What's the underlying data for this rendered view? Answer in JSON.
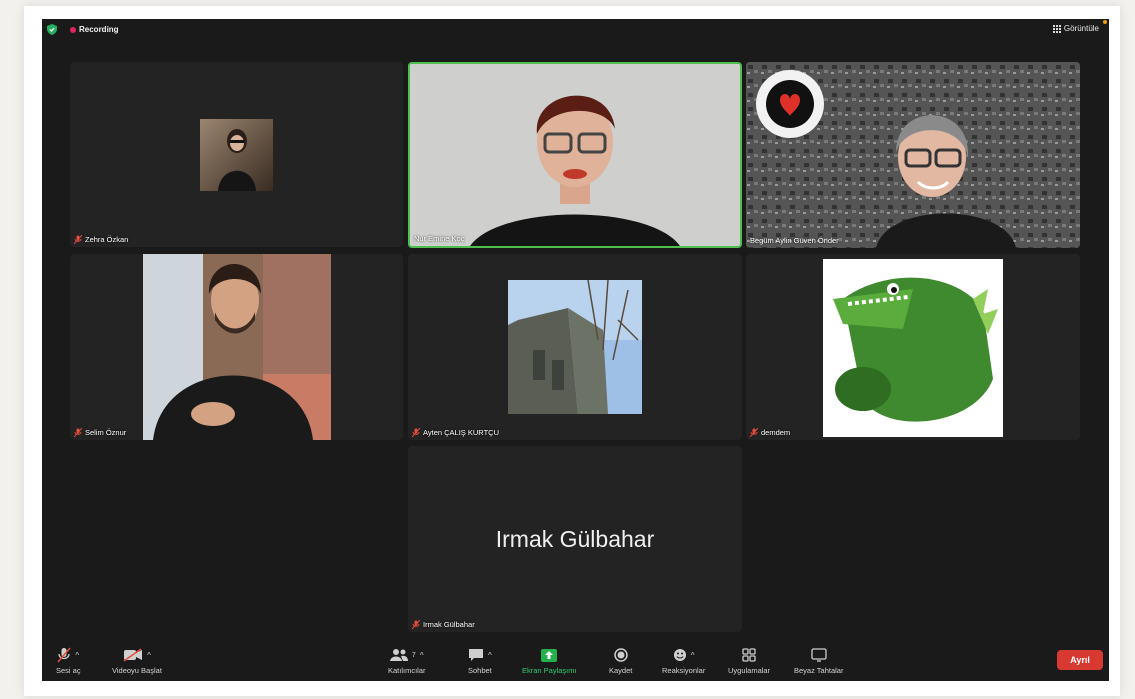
{
  "topbar": {
    "recording_label": "Recording",
    "view_label": "Görüntüle"
  },
  "participants": [
    {
      "name": "Zehra Özkan"
    },
    {
      "name": "Nur Emine Koç"
    },
    {
      "name": "Begüm Aylin Güven Önder"
    },
    {
      "name": "Selim Öznur"
    },
    {
      "name": "Ayten ÇALIŞ KURTÇU"
    },
    {
      "name": "demdem"
    },
    {
      "name": "Irmak Gülbahar"
    }
  ],
  "toolbar": {
    "mute_label": "Sesi aç",
    "video_label": "Videoyu Başlat",
    "participants_label": "Katılımcılar",
    "participants_count": "7",
    "chat_label": "Sohbet",
    "share_label": "Ekran Paylaşımı",
    "record_label": "Kaydet",
    "reactions_label": "Reaksiyonlar",
    "apps_label": "Uygulamalar",
    "whiteboard_label": "Beyaz Tahtalar",
    "leave_label": "Ayrıl"
  },
  "colors": {
    "accent_green": "#4fbf4f",
    "leave_red": "#d83a32",
    "recording_red": "#e0245e",
    "share_green": "#24b04a"
  },
  "icons": [
    "shield-icon",
    "recording-dot-icon",
    "grid-icon",
    "mic-muted-icon",
    "video-off-icon",
    "participants-icon",
    "chat-icon",
    "share-screen-icon",
    "record-icon",
    "reactions-icon",
    "apps-icon",
    "whiteboard-icon"
  ]
}
